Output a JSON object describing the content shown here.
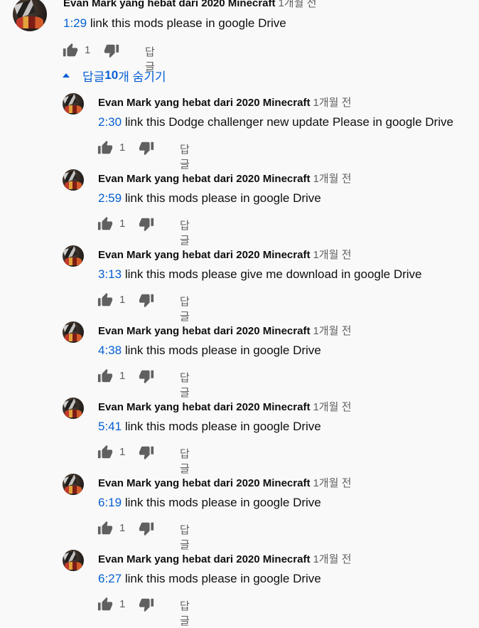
{
  "top_comment": {
    "author": "Evan Mark yang hebat dari 2020 Minecraft",
    "time": "1개월 전",
    "timestamp": "1:29",
    "text": " link this mods please in google Drive",
    "likes": "1",
    "reply_label": "답글"
  },
  "toggle": {
    "prefix": "답글 ",
    "count": "10",
    "suffix": "개 숨기기"
  },
  "replies": [
    {
      "author": "Evan Mark yang hebat dari 2020 Minecraft",
      "time": "1개월 전",
      "timestamp": "2:30",
      "text": " link this Dodge challenger new update Please in google Drive",
      "likes": "1",
      "reply_label": "답글"
    },
    {
      "author": "Evan Mark yang hebat dari 2020 Minecraft",
      "time": "1개월 전",
      "timestamp": "2:59",
      "text": " link this mods please in google Drive",
      "likes": "1",
      "reply_label": "답글"
    },
    {
      "author": "Evan Mark yang hebat dari 2020 Minecraft",
      "time": "1개월 전",
      "timestamp": "3:13",
      "text": " link this mods please give me download in google Drive",
      "likes": "1",
      "reply_label": "답글"
    },
    {
      "author": "Evan Mark yang hebat dari 2020 Minecraft",
      "time": "1개월 전",
      "timestamp": "4:38",
      "text": " link this mods please in google Drive",
      "likes": "1",
      "reply_label": "답글"
    },
    {
      "author": "Evan Mark yang hebat dari 2020 Minecraft",
      "time": "1개월 전",
      "timestamp": "5:41",
      "text": " link this mods please in google Drive",
      "likes": "1",
      "reply_label": "답글"
    },
    {
      "author": "Evan Mark yang hebat dari 2020 Minecraft",
      "time": "1개월 전",
      "timestamp": "6:19",
      "text": " link this mods please in google Drive",
      "likes": "1",
      "reply_label": "답글"
    },
    {
      "author": "Evan Mark yang hebat dari 2020 Minecraft",
      "time": "1개월 전",
      "timestamp": "6:27",
      "text": " link this mods please in google Drive",
      "likes": "1",
      "reply_label": "답글"
    }
  ],
  "colors": {
    "link": "#065fd4",
    "secondary": "#606060",
    "icon": "#606060",
    "background": "#f9f9f9"
  },
  "icons": {
    "like": "thumb-up-icon",
    "dislike": "thumb-down-icon",
    "toggle": "caret-up-icon"
  }
}
